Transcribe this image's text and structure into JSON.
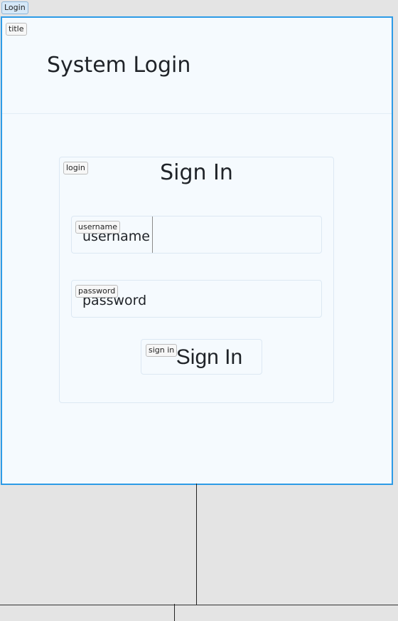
{
  "window": {
    "tag": "Login"
  },
  "title_section": {
    "tag": "title",
    "heading": "System Login"
  },
  "login_form": {
    "tag": "login",
    "heading": "Sign In",
    "username": {
      "tag": "username",
      "label": "username"
    },
    "password": {
      "tag": "password",
      "label": "password"
    },
    "sign_in": {
      "tag": "sign in",
      "label": "Sign In"
    }
  },
  "colors": {
    "accent": "#2d9be6",
    "panel": "#f5fafe",
    "border": "#dce8f3",
    "desktop": "#e4e4e4"
  }
}
